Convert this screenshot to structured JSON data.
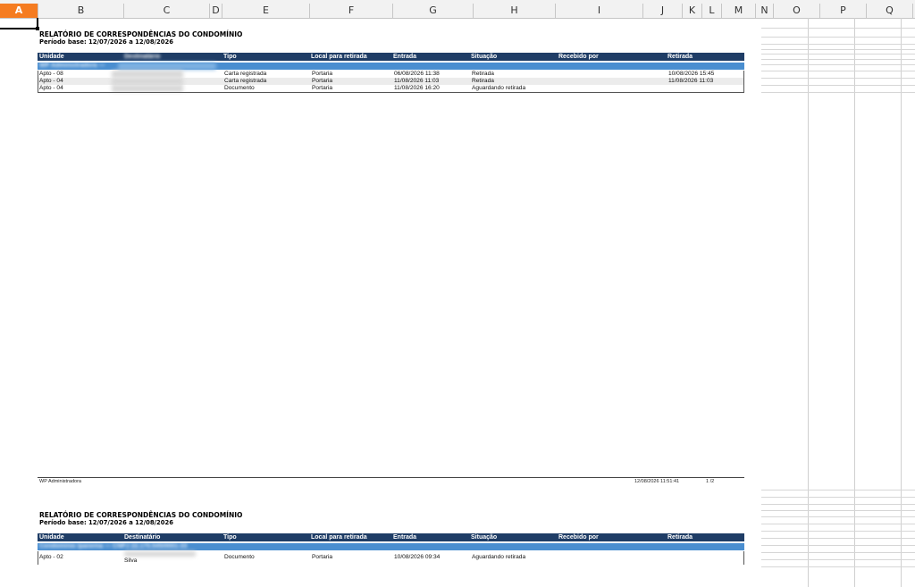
{
  "spreadsheet": {
    "columns": [
      "A",
      "B",
      "C",
      "D",
      "E",
      "F",
      "G",
      "H",
      "I",
      "J",
      "K",
      "L",
      "M",
      "N",
      "O",
      "P",
      "Q"
    ],
    "active_column": "A"
  },
  "report": {
    "title": "RELATÓRIO DE CORRESPONDÊNCIAS DO CONDOMÍNIO",
    "period": "Período base: 12/07/2026 a 12/08/2026",
    "headers": [
      "Unidade",
      "Destinatário",
      "Tipo",
      "Local para retirada",
      "Entrada",
      "Situação",
      "Recebido por",
      "Retirada"
    ]
  },
  "page1": {
    "group_label": "WP Administradora —",
    "rows": [
      {
        "unidade": "Apto - 08",
        "tipo": "Carta registrada",
        "local": "Portaria",
        "entrada": "06/08/2026 11:38",
        "situacao": "Retirada",
        "recebido": "",
        "retirada": "10/08/2026 15:45"
      },
      {
        "unidade": "Apto - 04",
        "tipo": "Carta registrada",
        "local": "Portaria",
        "entrada": "11/08/2026 11:03",
        "situacao": "Retirada",
        "recebido": "",
        "retirada": "11/08/2026 11:03"
      },
      {
        "unidade": "Apto - 04",
        "tipo": "Documento",
        "local": "Portaria",
        "entrada": "11/08/2026 16:20",
        "situacao": "Aguardando retirada",
        "recebido": "",
        "retirada": ""
      }
    ],
    "footer_left": "WP Administradora",
    "footer_date": "12/08/2026 11:51:41",
    "footer_page": "1 /2"
  },
  "page2": {
    "group_label": "Condomínio Ipanema — CNPJ 22.170.545/0001-33",
    "group_label_clear": "— CNPJ",
    "rows": [
      {
        "unidade": "Apto - 02",
        "destinatario_line2": "Silva",
        "tipo": "Documento",
        "local": "Portaria",
        "entrada": "10/08/2026 09:34",
        "situacao": "Aguardando retirada",
        "recebido": "",
        "retirada": ""
      }
    ]
  }
}
